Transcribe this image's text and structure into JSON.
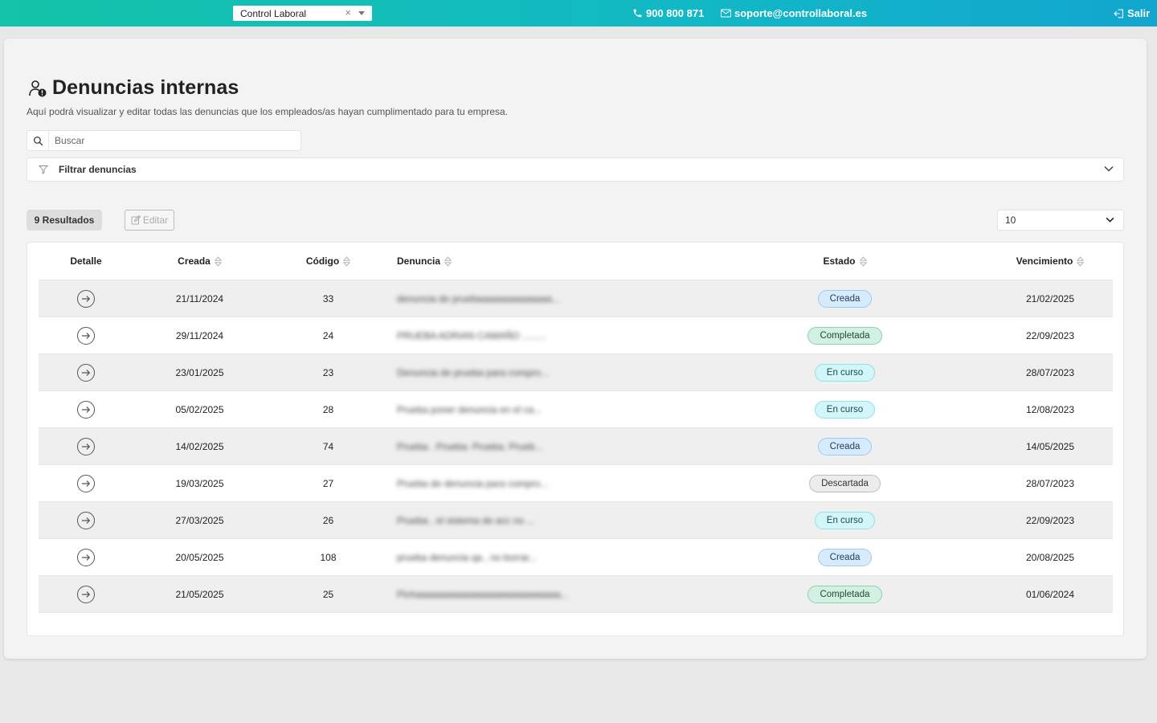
{
  "topbar": {
    "company": "Control Laboral",
    "clear_glyph": "×",
    "phone": "900 800 871",
    "email": "soporte@controllaboral.es",
    "logout": "Salir"
  },
  "page": {
    "title": "Denuncias internas",
    "subtitle": "Aquí podrá visualizar y editar todas las denuncias que los empleados/as hayan cumplimentado para tu empresa.",
    "search_placeholder": "Buscar",
    "filter_label": "Filtrar denuncias",
    "results": "9 Resultados",
    "edit": "Editar",
    "page_size": "10"
  },
  "table": {
    "headers": {
      "detalle": "Detalle",
      "creada": "Creada",
      "codigo": "Código",
      "denuncia": "Denuncia",
      "estado": "Estado",
      "vencimiento": "Vencimiento"
    },
    "rows": [
      {
        "creada": "21/11/2024",
        "codigo": "33",
        "denuncia": "denuncia de pruebaaaaaaaaaaaaaa...",
        "estado": "Creada",
        "estado_kind": "creada",
        "vencimiento": "21/02/2025"
      },
      {
        "creada": "29/11/2024",
        "codigo": "24",
        "denuncia": "PRUEBA ADRIAN CAMAÑO .........",
        "estado": "Completada",
        "estado_kind": "completada",
        "vencimiento": "22/09/2023"
      },
      {
        "creada": "23/01/2025",
        "codigo": "23",
        "denuncia": "Denuncia de prueba para compro...",
        "estado": "En curso",
        "estado_kind": "encurso",
        "vencimiento": "28/07/2023"
      },
      {
        "creada": "05/02/2025",
        "codigo": "28",
        "denuncia": "Prueba poner denuncia en el ca...",
        "estado": "En curso",
        "estado_kind": "encurso",
        "vencimiento": "12/08/2023"
      },
      {
        "creada": "14/02/2025",
        "codigo": "74",
        "denuncia": "Prueba . Prueba. Prueba. Prueb...",
        "estado": "Creada",
        "estado_kind": "creada",
        "vencimiento": "14/05/2025"
      },
      {
        "creada": "19/03/2025",
        "codigo": "27",
        "denuncia": "Prueba de denuncia para compro...",
        "estado": "Descartada",
        "estado_kind": "descartada",
        "vencimiento": "28/07/2023"
      },
      {
        "creada": "27/03/2025",
        "codigo": "26",
        "denuncia": "Prueba , el sistema de acc no ...",
        "estado": "En curso",
        "estado_kind": "encurso",
        "vencimiento": "22/09/2023"
      },
      {
        "creada": "20/05/2025",
        "codigo": "108",
        "denuncia": "prueba denuncia qa , no borrar...",
        "estado": "Creada",
        "estado_kind": "creada",
        "vencimiento": "20/08/2025"
      },
      {
        "creada": "21/05/2025",
        "codigo": "25",
        "denuncia": "Pichaaaaaaaaaaaaaaaaaaaaaaaaaaa...",
        "estado": "Completada",
        "estado_kind": "completada",
        "vencimiento": "01/06/2024"
      }
    ]
  }
}
